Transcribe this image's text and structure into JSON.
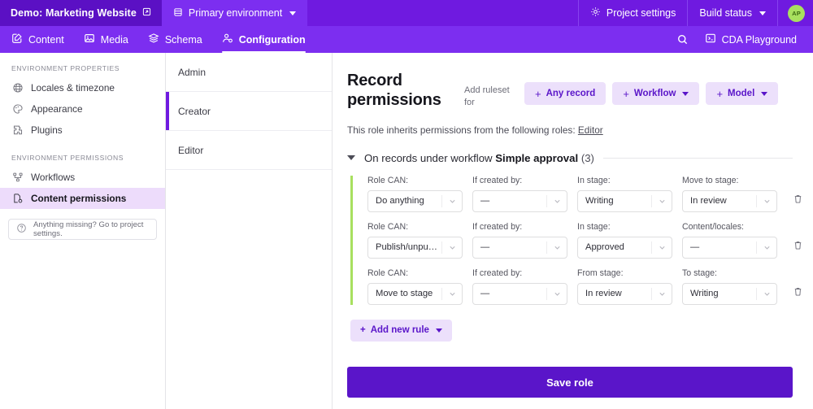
{
  "topbar": {
    "project_name": "Demo: Marketing Website",
    "project_icon": "open-in-box-icon",
    "environment": "Primary environment",
    "environment_icon": "database-icon",
    "project_settings": "Project settings",
    "project_settings_icon": "gear-icon",
    "build_status": "Build status",
    "avatar_initials": "AP",
    "avatar_color": "#a8e05f",
    "bar_color": "#6f1ae0"
  },
  "navbar": {
    "items": [
      {
        "label": "Content",
        "icon": "edit-pencil-square-icon",
        "active": false
      },
      {
        "label": "Media",
        "icon": "image-icon",
        "active": false
      },
      {
        "label": "Schema",
        "icon": "layers-stack-icon",
        "active": false
      },
      {
        "label": "Configuration",
        "icon": "user-gear-icon",
        "active": true
      }
    ],
    "search_icon": "search-icon",
    "cda_label": "CDA Playground",
    "cda_icon": "terminal-box-icon",
    "bar_color": "#7c2ef0"
  },
  "sidebar": {
    "groups": [
      {
        "title": "ENVIRONMENT PROPERTIES",
        "items": [
          {
            "label": "Locales & timezone",
            "icon": "globe-icon",
            "active": false
          },
          {
            "label": "Appearance",
            "icon": "palette-icon",
            "active": false
          },
          {
            "label": "Plugins",
            "icon": "puzzle-piece-icon",
            "active": false
          }
        ]
      },
      {
        "title": "ENVIRONMENT PERMISSIONS",
        "items": [
          {
            "label": "Workflows",
            "icon": "workflow-nodes-icon",
            "active": false
          },
          {
            "label": "Content permissions",
            "icon": "document-gear-icon",
            "active": true
          }
        ]
      }
    ],
    "missing_note": "Anything missing? Go to project settings.",
    "missing_icon": "question-circle-icon",
    "active_bg": "#eddcfb"
  },
  "roles": {
    "items": [
      {
        "label": "Admin",
        "active": false
      },
      {
        "label": "Creator",
        "active": true
      },
      {
        "label": "Editor",
        "active": false
      }
    ],
    "active_marker_color": "#6f1ae0"
  },
  "main": {
    "title": "Record permissions",
    "add_ruleset_label": "Add ruleset for",
    "ruleset_buttons": [
      {
        "label": "Any record",
        "has_caret": false
      },
      {
        "label": "Workflow",
        "has_caret": true
      },
      {
        "label": "Model",
        "has_caret": true
      }
    ],
    "inherits_text": "This role inherits permissions from the following roles:",
    "inherits_role": "Editor",
    "section": {
      "prefix": "On records under workflow",
      "workflow_name": "Simple approval",
      "count": "(3)",
      "expanded": true
    },
    "accent_bar_color": "#a8e05f",
    "rules": [
      {
        "fields": [
          {
            "label": "Role CAN:",
            "value": "Do anything"
          },
          {
            "label": "If created by:",
            "value": "—"
          },
          {
            "label": "In stage:",
            "value": "Writing"
          },
          {
            "label": "Move to stage:",
            "value": "In review"
          }
        ],
        "delete_icon": "trash-icon"
      },
      {
        "fields": [
          {
            "label": "Role CAN:",
            "value": "Publish/unpub…"
          },
          {
            "label": "If created by:",
            "value": "—"
          },
          {
            "label": "In stage:",
            "value": "Approved"
          },
          {
            "label": "Content/locales:",
            "value": "—"
          }
        ],
        "delete_icon": "trash-icon"
      },
      {
        "fields": [
          {
            "label": "Role CAN:",
            "value": "Move to stage"
          },
          {
            "label": "If created by:",
            "value": "—"
          },
          {
            "label": "From stage:",
            "value": "In review"
          },
          {
            "label": "To stage:",
            "value": "Writing"
          }
        ],
        "delete_icon": "trash-icon"
      }
    ],
    "add_rule_label": "Add new rule",
    "save_label": "Save role",
    "save_color": "#5a15c9"
  }
}
